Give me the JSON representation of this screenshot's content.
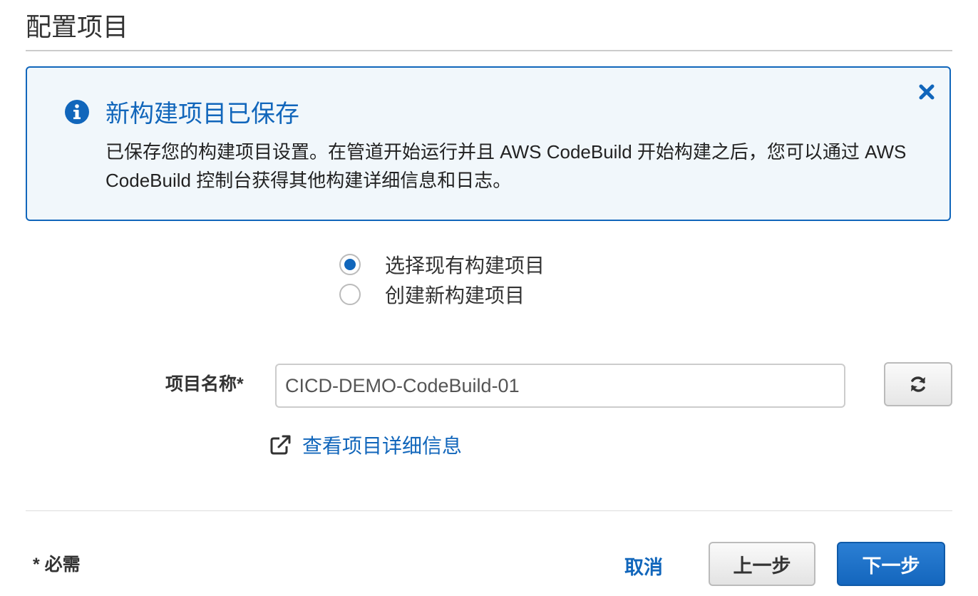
{
  "page": {
    "title": "配置项目"
  },
  "alert": {
    "icon": "info-icon",
    "close_icon": "close-icon",
    "title": "新构建项目已保存",
    "body": "已保存您的构建项目设置。在管道开始运行并且 AWS CodeBuild 开始构建之后，您可以通过 AWS CodeBuild 控制台获得其他构建详细信息和日志。",
    "accent_color": "#1166bb",
    "background_color": "#f1f7fb"
  },
  "project_choice": {
    "options": [
      {
        "label": "选择现有构建项目",
        "selected": true
      },
      {
        "label": "创建新构建项目",
        "selected": false
      }
    ]
  },
  "project_name": {
    "label": "项目名称*",
    "value": "CICD-DEMO-CodeBuild-01",
    "refresh_icon": "refresh-icon"
  },
  "details_link": {
    "icon": "external-link-icon",
    "label": "查看项目详细信息"
  },
  "footer": {
    "required_note": "* 必需",
    "cancel_label": "取消",
    "prev_label": "上一步",
    "next_label": "下一步",
    "primary_color": "#1466bd"
  }
}
